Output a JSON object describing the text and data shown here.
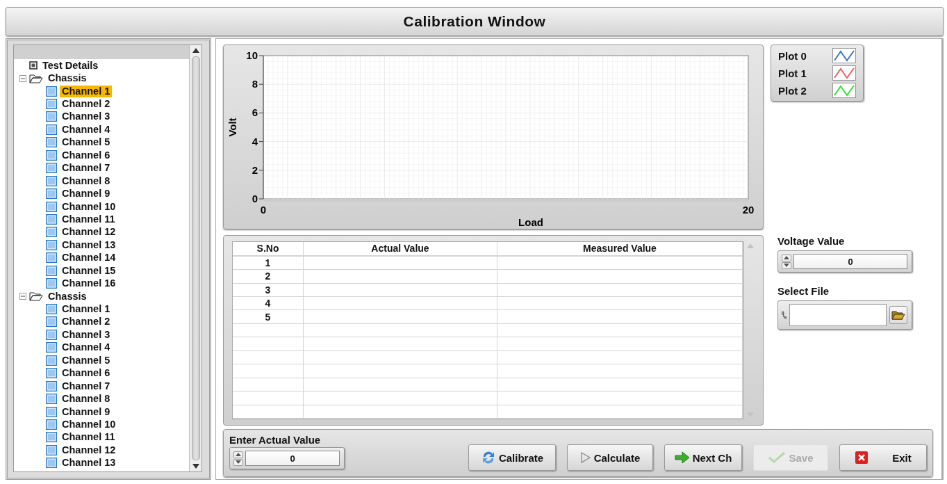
{
  "window": {
    "title": "Calibration Window"
  },
  "tree": [
    {
      "label": "Test Details",
      "kind": "item"
    },
    {
      "label": "Chassis",
      "kind": "folder",
      "expanded": true,
      "children": [
        {
          "label": "Channel 1",
          "selected": true
        },
        {
          "label": "Channel 2",
          "selected": false
        },
        {
          "label": "Channel 3",
          "selected": false
        },
        {
          "label": "Channel 4",
          "selected": false
        },
        {
          "label": "Channel 5",
          "selected": false
        },
        {
          "label": "Channel 6",
          "selected": false
        },
        {
          "label": "Channel 7",
          "selected": false
        },
        {
          "label": "Channel 8",
          "selected": false
        },
        {
          "label": "Channel 9",
          "selected": false
        },
        {
          "label": "Channel 10",
          "selected": false
        },
        {
          "label": "Channel 11",
          "selected": false
        },
        {
          "label": "Channel 12",
          "selected": false
        },
        {
          "label": "Channel 13",
          "selected": false
        },
        {
          "label": "Channel 14",
          "selected": false
        },
        {
          "label": "Channel 15",
          "selected": false
        },
        {
          "label": "Channel 16",
          "selected": false
        }
      ]
    },
    {
      "label": "Chassis",
      "kind": "folder",
      "expanded": true,
      "children": [
        {
          "label": "Channel 1",
          "selected": false
        },
        {
          "label": "Channel 2",
          "selected": false
        },
        {
          "label": "Channel 3",
          "selected": false
        },
        {
          "label": "Channel 4",
          "selected": false
        },
        {
          "label": "Channel 5",
          "selected": false
        },
        {
          "label": "Channel 6",
          "selected": false
        },
        {
          "label": "Channel 7",
          "selected": false
        },
        {
          "label": "Channel 8",
          "selected": false
        },
        {
          "label": "Channel 9",
          "selected": false
        },
        {
          "label": "Channel 10",
          "selected": false
        },
        {
          "label": "Channel 11",
          "selected": false
        },
        {
          "label": "Channel 12",
          "selected": false
        },
        {
          "label": "Channel 13",
          "selected": false
        }
      ]
    }
  ],
  "chart": {
    "chart_data": {
      "type": "line",
      "xlabel": "Load",
      "ylabel": "Volt",
      "xlim": [
        0,
        20
      ],
      "ylim": [
        0,
        10
      ],
      "xticks": [
        0,
        20
      ],
      "grid": true,
      "yticks": [
        0,
        2,
        4,
        6,
        8,
        10
      ]
    }
  },
  "legend": [
    {
      "name": "Plot 0",
      "color": "#3c78c0"
    },
    {
      "name": "Plot 1",
      "color": "#f06060"
    },
    {
      "name": "Plot 2",
      "color": "#30e030"
    }
  ],
  "table": {
    "columns": [
      "S.No",
      "Actual Value",
      "Measured Value"
    ],
    "rows": [
      {
        "s_no": "1"
      },
      {
        "s_no": "2"
      },
      {
        "s_no": "3"
      },
      {
        "s_no": "4"
      },
      {
        "s_no": "5"
      }
    ]
  },
  "voltage_value": {
    "label": "Voltage Value",
    "value": "0"
  },
  "select_file": {
    "label": "Select File"
  },
  "enter_actual_value": {
    "label": "Enter Actual Value",
    "value": "0"
  },
  "buttons": [
    {
      "label": "Calibrate",
      "kind": "calibrate",
      "disabled": false
    },
    {
      "label": "Calculate",
      "kind": "calculate",
      "disabled": false
    },
    {
      "label": "Next Ch",
      "kind": "next",
      "disabled": false
    },
    {
      "label": "Save",
      "kind": "save",
      "disabled": true
    },
    {
      "label": "Exit",
      "kind": "exit",
      "disabled": false
    }
  ]
}
